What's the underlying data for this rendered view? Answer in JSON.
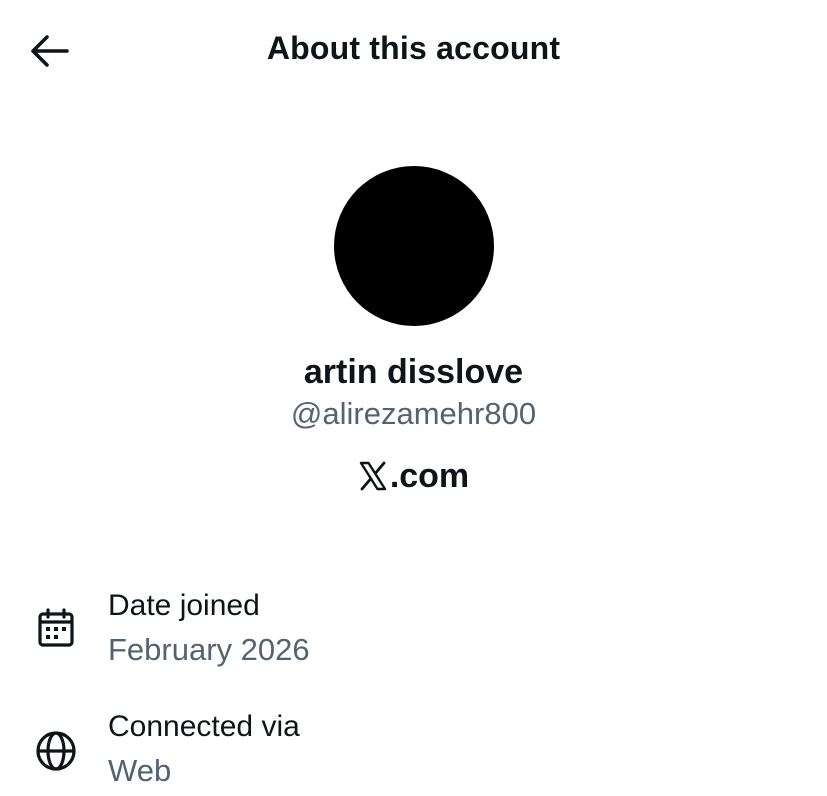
{
  "header": {
    "title": "About this account",
    "back_icon": "arrow-left-icon"
  },
  "profile": {
    "avatar_color": "#000000",
    "display_name": "artin disslove",
    "handle": "@alirezamehr800",
    "platform_logo": "x-logo-icon",
    "platform_domain": ".com"
  },
  "details": {
    "date_joined": {
      "icon": "calendar-icon",
      "label": "Date joined",
      "value": "February 2026"
    },
    "connected_via": {
      "icon": "globe-icon",
      "label": "Connected via",
      "value": "Web"
    }
  },
  "colors": {
    "primary_text": "#0f1419",
    "secondary_text": "#536471",
    "background": "#ffffff"
  }
}
